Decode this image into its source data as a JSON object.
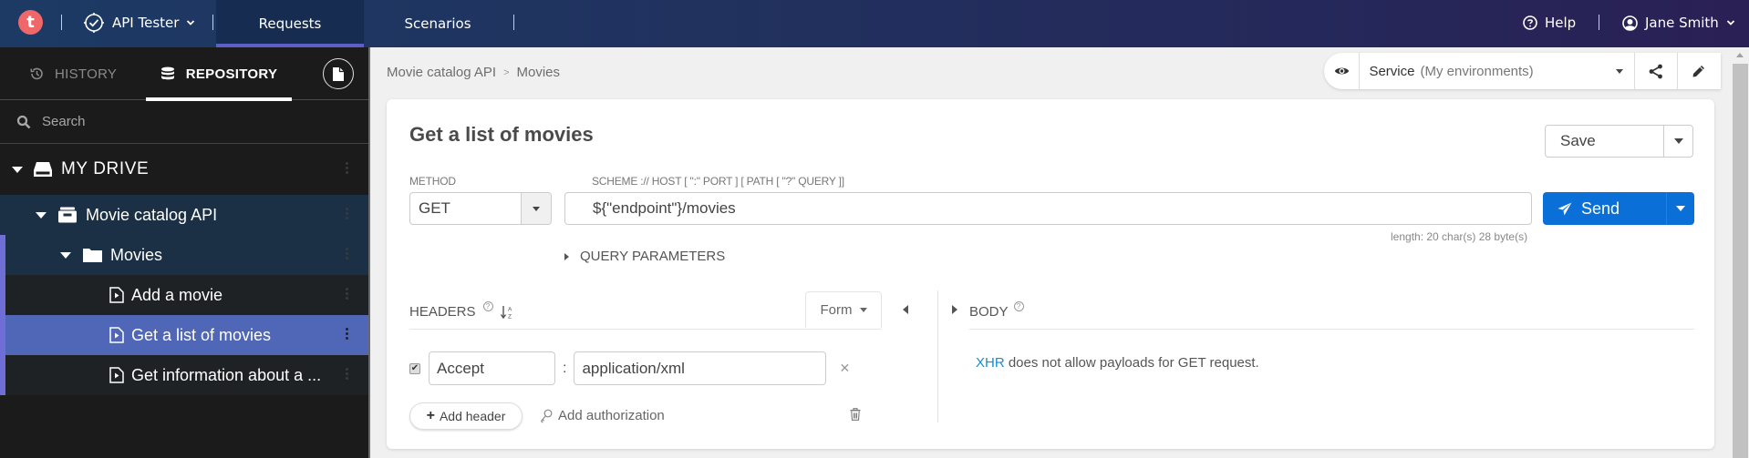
{
  "topbar": {
    "logo_letter": "t",
    "app_name": "API Tester",
    "tabs": [
      {
        "label": "Requests",
        "active": true
      },
      {
        "label": "Scenarios",
        "active": false
      }
    ],
    "help_label": "Help",
    "user_name": "Jane Smith"
  },
  "sidebar": {
    "tabs": [
      {
        "label": "HISTORY",
        "icon": "history-icon",
        "active": false
      },
      {
        "label": "REPOSITORY",
        "icon": "database-icon",
        "active": true
      }
    ],
    "new_file_icon": "new-file-icon",
    "search_placeholder": "Search",
    "tree": {
      "drive": "MY DRIVE",
      "api": "Movie catalog API",
      "folder": "Movies",
      "requests": [
        {
          "label": "Add a movie",
          "selected": false
        },
        {
          "label": "Get a list of movies",
          "selected": true
        },
        {
          "label": "Get information about a ...",
          "selected": false
        }
      ]
    }
  },
  "main": {
    "breadcrumb": [
      "Movie catalog API",
      "Movies"
    ],
    "environment": {
      "name": "Service",
      "hint": "(My environments)"
    },
    "request": {
      "title": "Get a list of movies",
      "save_label": "Save",
      "method_label": "METHOD",
      "method": "GET",
      "url_label": "SCHEME :// HOST [ \":\" PORT ] [ PATH [ \"?\" QUERY ]]",
      "url": "${\"endpoint\"}/movies",
      "url_length": "length: 20 char(s) 28 byte(s)",
      "send_label": "Send",
      "query_params_label": "QUERY PARAMETERS"
    },
    "headers": {
      "label": "HEADERS",
      "help": "?",
      "mode": "Form",
      "rows": [
        {
          "enabled": true,
          "name": "Accept",
          "value": "application/xml"
        }
      ],
      "add_header_label": "Add header",
      "add_auth_label": "Add authorization"
    },
    "body": {
      "label": "BODY",
      "help": "?",
      "message_link": "XHR",
      "message_text": " does not allow payloads for GET request."
    }
  },
  "colors": {
    "accent": "#5b5fc7",
    "send_button": "#0a6fd6",
    "selected_row": "#4f67b6",
    "logo": "#f0676a",
    "link": "#1a8bd0"
  }
}
